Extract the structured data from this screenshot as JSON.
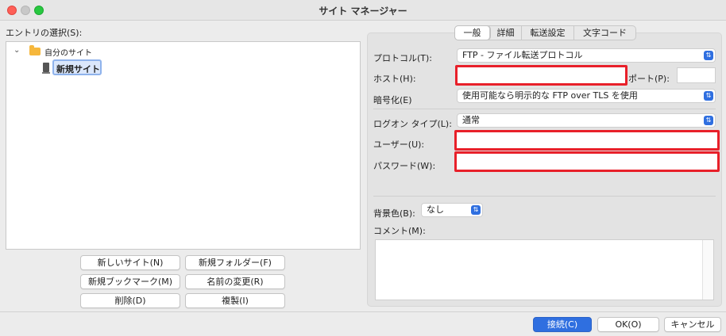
{
  "window": {
    "title": "サイト マネージャー"
  },
  "tree": {
    "heading": "エントリの選択(S):",
    "root_label": "自分のサイト",
    "selected_site": "新規サイト"
  },
  "left_buttons": {
    "new_site": "新しいサイト(N)",
    "new_folder": "新規フォルダー(F)",
    "new_bookmark": "新規ブックマーク(M)",
    "rename": "名前の変更(R)",
    "delete": "削除(D)",
    "duplicate": "複製(I)"
  },
  "tabs": [
    "一般",
    "詳細",
    "転送設定",
    "文字コード"
  ],
  "form": {
    "protocol_label": "プロトコル(T):",
    "protocol_value": "FTP - ファイル転送プロトコル",
    "host_label": "ホスト(H):",
    "host_value": "",
    "port_label": "ポート(P):",
    "port_value": "",
    "encryption_label": "暗号化(E)",
    "encryption_value": "使用可能なら明示的な FTP over TLS を使用",
    "logon_label": "ログオン タイプ(L):",
    "logon_value": "通常",
    "user_label": "ユーザー(U):",
    "user_value": "",
    "password_label": "パスワード(W):",
    "password_value": "",
    "bgcolor_label": "背景色(B):",
    "bgcolor_value": "なし",
    "comment_label": "コメント(M):"
  },
  "footer": {
    "connect": "接続(C)",
    "ok": "OK(O)",
    "cancel": "キャンセル"
  },
  "colors": {
    "accent": "#2f6fe0",
    "highlight": "#e8202a",
    "folder": "#f6b73c"
  },
  "icons": {
    "expand": "chevron-down-icon",
    "folder": "folder-icon",
    "site": "server-icon",
    "stepper": "up-down-stepper-icon"
  }
}
